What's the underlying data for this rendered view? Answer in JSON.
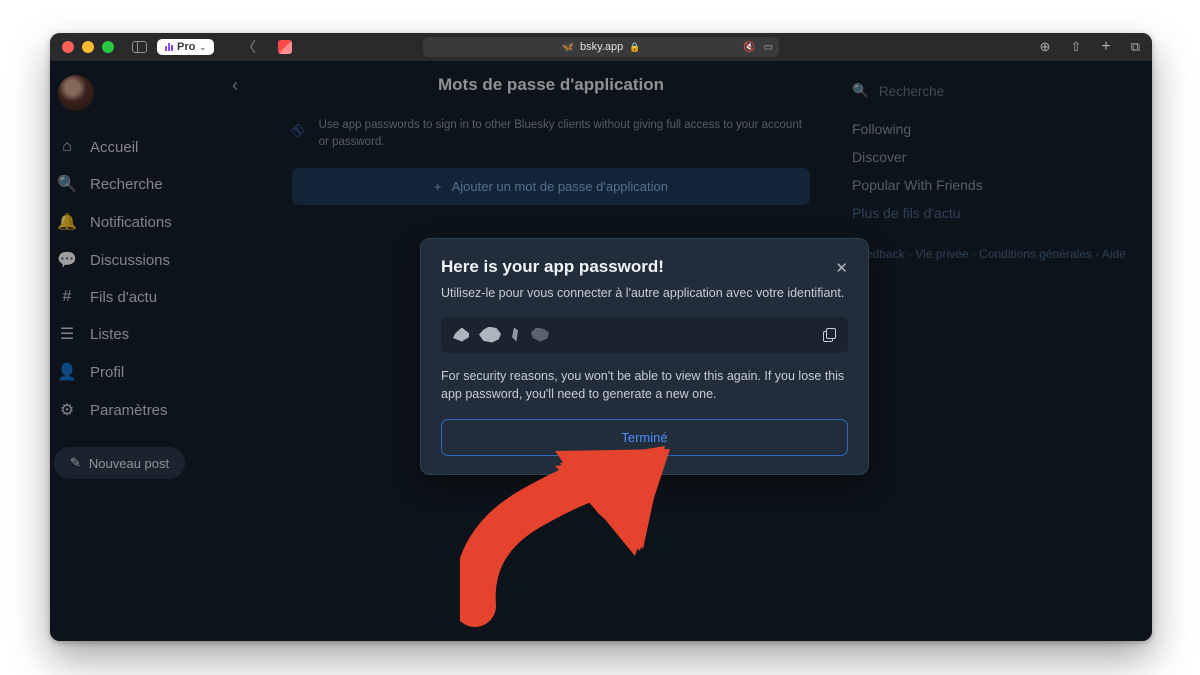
{
  "browser": {
    "pro_label": "Pro",
    "url": "bsky.app"
  },
  "sidebar": {
    "items": [
      {
        "label": "Accueil"
      },
      {
        "label": "Recherche"
      },
      {
        "label": "Notifications"
      },
      {
        "label": "Discussions"
      },
      {
        "label": "Fils d'actu"
      },
      {
        "label": "Listes"
      },
      {
        "label": "Profil"
      },
      {
        "label": "Paramètres"
      }
    ],
    "new_post_label": "Nouveau post"
  },
  "page": {
    "title": "Mots de passe d'application",
    "info_text": "Use app passwords to sign in to other Bluesky clients without giving full access to your account or password.",
    "add_button_label": "Ajouter un mot de passe d'application"
  },
  "right": {
    "search_placeholder": "Recherche",
    "feeds": [
      {
        "label": "Following"
      },
      {
        "label": "Discover"
      },
      {
        "label": "Popular With Friends"
      },
      {
        "label": "Plus de fils d'actu"
      }
    ],
    "footer": "Feedback · Vie privée · Conditions générales · Aide"
  },
  "modal": {
    "title": "Here is your app password!",
    "subtitle": "Utilisez-le pour vous connecter à l'autre application avec votre identifiant.",
    "warning": "For security reasons, you won't be able to view this again. If you lose this app password, you'll need to generate a new one.",
    "done_label": "Terminé"
  }
}
